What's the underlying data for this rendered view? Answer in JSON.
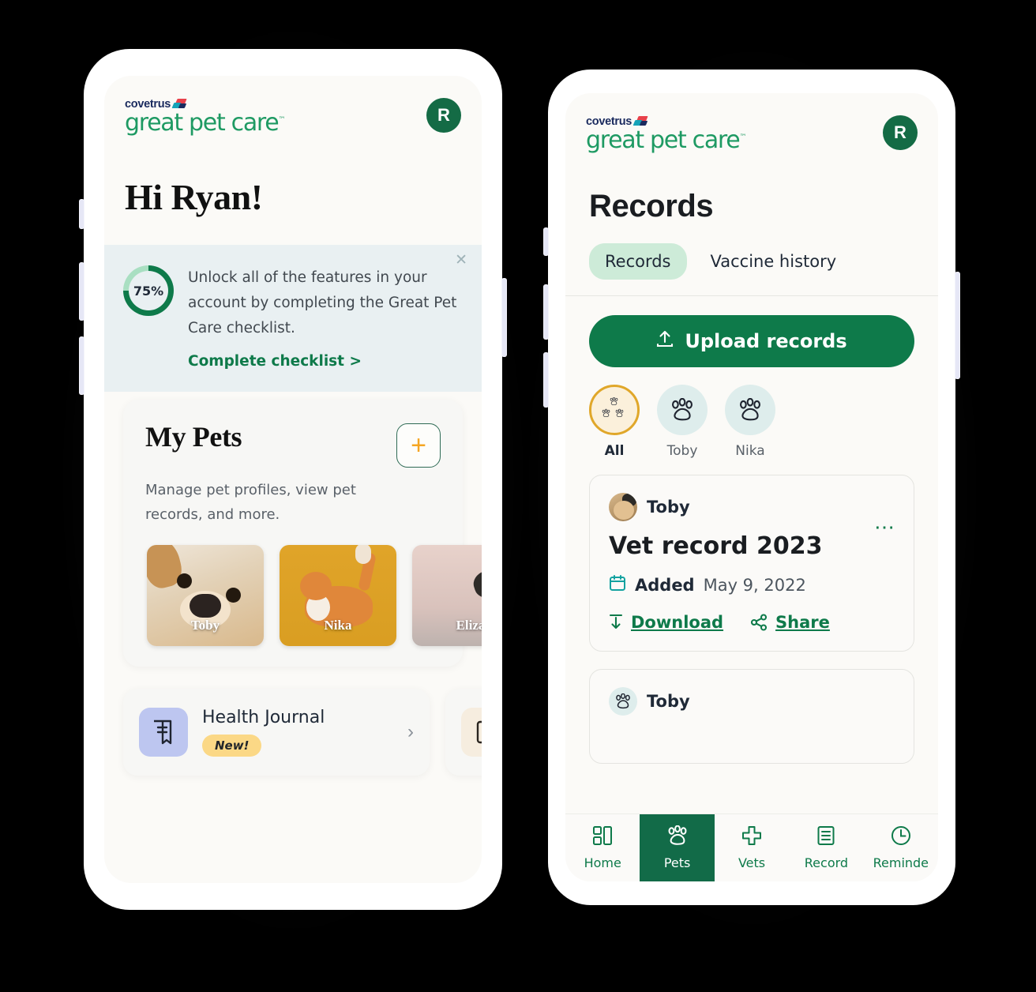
{
  "brand": {
    "covetrus": "covetrus",
    "product": "great pet care",
    "tm": "™",
    "avatar_initial": "R",
    "green": "#0E7A4A",
    "dark_green": "#146B45",
    "gold": "#E0A72A"
  },
  "left_screen": {
    "greeting": "Hi Ryan!",
    "checklist": {
      "percent_label": "75%",
      "percent_value": 75,
      "body": "Unlock all of the features in your account by completing the Great Pet Care checklist.",
      "link": "Complete checklist >",
      "close_icon": "close-icon"
    },
    "my_pets": {
      "title": "My Pets",
      "add_icon": "plus-icon",
      "subtitle": "Manage pet profiles, view pet records, and more.",
      "pets": [
        {
          "name": "Toby",
          "art": "dog"
        },
        {
          "name": "Nika",
          "art": "cat"
        },
        {
          "name": "Eliza",
          "art": "pink"
        }
      ]
    },
    "features": [
      {
        "title": "Health Journal",
        "badge": "New!",
        "icon": "journal-icon",
        "chevron": "›"
      },
      {
        "title": "",
        "badge": "",
        "icon": "book-icon",
        "chevron": ""
      }
    ]
  },
  "right_screen": {
    "page_title": "Records",
    "tabs": [
      {
        "label": "Records",
        "active": true
      },
      {
        "label": "Vaccine history",
        "active": false
      }
    ],
    "upload_button": {
      "label": "Upload records",
      "icon": "upload-icon"
    },
    "filters": [
      {
        "label": "All",
        "icon": "three-paws-icon",
        "selected": true
      },
      {
        "label": "Toby",
        "icon": "paw-icon",
        "selected": false
      },
      {
        "label": "Nika",
        "icon": "paw-icon",
        "selected": false
      }
    ],
    "records": [
      {
        "pet": "Toby",
        "name": "Vet record 2023",
        "added_label": "Added",
        "added_date": "May 9, 2022",
        "download_label": "Download",
        "share_label": "Share",
        "more_icon": "more-horizontal-icon"
      },
      {
        "pet": "Toby",
        "name": "",
        "added_label": "",
        "added_date": "",
        "download_label": "",
        "share_label": "",
        "more_icon": ""
      }
    ],
    "bottom_nav": [
      {
        "label": "Home",
        "icon": "dashboard-icon",
        "active": false
      },
      {
        "label": "Pets",
        "icon": "paw-icon",
        "active": true
      },
      {
        "label": "Vets",
        "icon": "cross-icon",
        "active": false
      },
      {
        "label": "Record",
        "icon": "document-icon",
        "active": false
      },
      {
        "label": "Reminde",
        "icon": "clock-icon",
        "active": false
      }
    ]
  }
}
